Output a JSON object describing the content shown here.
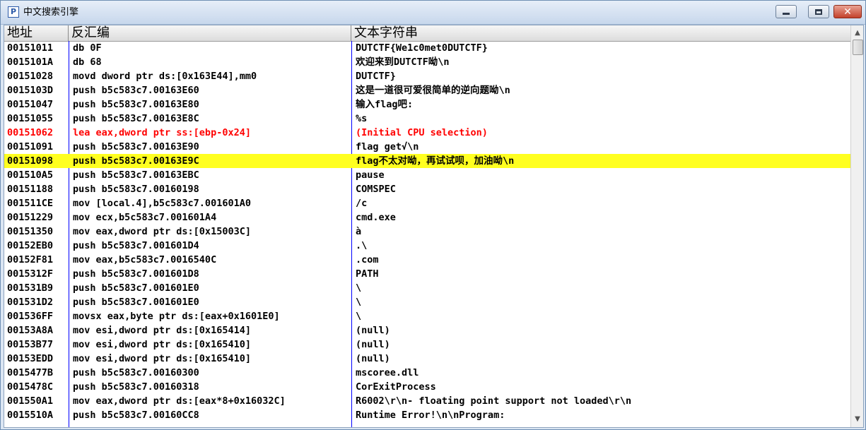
{
  "window": {
    "title": "中文搜索引擎",
    "icon_letter": "P"
  },
  "columns": {
    "address": "地址",
    "disassembly": "反汇编",
    "text": "文本字符串"
  },
  "rows": [
    {
      "address": "00151011",
      "disassembly": "db 0F",
      "text": "DUTCTF{We1c0met0DUTCTF}"
    },
    {
      "address": "0015101A",
      "disassembly": "db 68",
      "text": "欢迎来到DUTCTF呦\\n"
    },
    {
      "address": "00151028",
      "disassembly": "movd dword ptr ds:[0x163E44],mm0",
      "text": "DUTCTF}"
    },
    {
      "address": "0015103D",
      "disassembly": "push b5c583c7.00163E60",
      "text": "这是一道很可爱很简单的逆向题呦\\n"
    },
    {
      "address": "00151047",
      "disassembly": "push b5c583c7.00163E80",
      "text": "输入flag吧:"
    },
    {
      "address": "00151055",
      "disassembly": "push b5c583c7.00163E8C",
      "text": "%s"
    },
    {
      "address": "00151062",
      "disassembly": "lea eax,dword ptr ss:[ebp-0x24]",
      "text": "(Initial CPU selection)",
      "state": "cpu"
    },
    {
      "address": "00151091",
      "disassembly": "push b5c583c7.00163E90",
      "text": "flag get√\\n"
    },
    {
      "address": "00151098",
      "disassembly": "push b5c583c7.00163E9C",
      "text": "flag不太对呦，再试试呗，加油呦\\n",
      "state": "selected"
    },
    {
      "address": "001510A5",
      "disassembly": "push b5c583c7.00163EBC",
      "text": "pause"
    },
    {
      "address": "00151188",
      "disassembly": "push b5c583c7.00160198",
      "text": "COMSPEC"
    },
    {
      "address": "001511CE",
      "disassembly": "mov [local.4],b5c583c7.001601A0",
      "text": "/c"
    },
    {
      "address": "00151229",
      "disassembly": "mov ecx,b5c583c7.001601A4",
      "text": "cmd.exe"
    },
    {
      "address": "00151350",
      "disassembly": "mov eax,dword ptr ds:[0x15003C]",
      "text": "à"
    },
    {
      "address": "00152EB0",
      "disassembly": "push b5c583c7.001601D4",
      "text": ".\\"
    },
    {
      "address": "00152F81",
      "disassembly": "mov eax,b5c583c7.0016540C",
      "text": ".com"
    },
    {
      "address": "0015312F",
      "disassembly": "push b5c583c7.001601D8",
      "text": "PATH"
    },
    {
      "address": "001531B9",
      "disassembly": "push b5c583c7.001601E0",
      "text": "\\"
    },
    {
      "address": "001531D2",
      "disassembly": "push b5c583c7.001601E0",
      "text": "\\"
    },
    {
      "address": "001536FF",
      "disassembly": "movsx eax,byte ptr ds:[eax+0x1601E0]",
      "text": "\\"
    },
    {
      "address": "00153A8A",
      "disassembly": "mov esi,dword ptr ds:[0x165414]",
      "text": "(null)"
    },
    {
      "address": "00153B77",
      "disassembly": "mov esi,dword ptr ds:[0x165410]",
      "text": "(null)"
    },
    {
      "address": "00153EDD",
      "disassembly": "mov esi,dword ptr ds:[0x165410]",
      "text": "(null)"
    },
    {
      "address": "0015477B",
      "disassembly": "push b5c583c7.00160300",
      "text": "mscoree.dll"
    },
    {
      "address": "0015478C",
      "disassembly": "push b5c583c7.00160318",
      "text": "CorExitProcess"
    },
    {
      "address": "001550A1",
      "disassembly": "mov eax,dword ptr ds:[eax*8+0x16032C]",
      "text": "R6002\\r\\n- floating point support not loaded\\r\\n"
    },
    {
      "address": "0015510A",
      "disassembly": "push b5c583c7.00160CC8",
      "text": "Runtime Error!\\n\\nProgram:"
    }
  ],
  "colors": {
    "selected_row": "#ffff20",
    "cpu_row_text": "#ff0000",
    "column_separator": "#0000ff"
  },
  "icons": {
    "app": "app-icon",
    "minimize": "minimize-icon",
    "maximize": "maximize-icon",
    "close": "close-icon",
    "scroll_up": "chevron-up-icon",
    "scroll_down": "chevron-down-icon"
  }
}
